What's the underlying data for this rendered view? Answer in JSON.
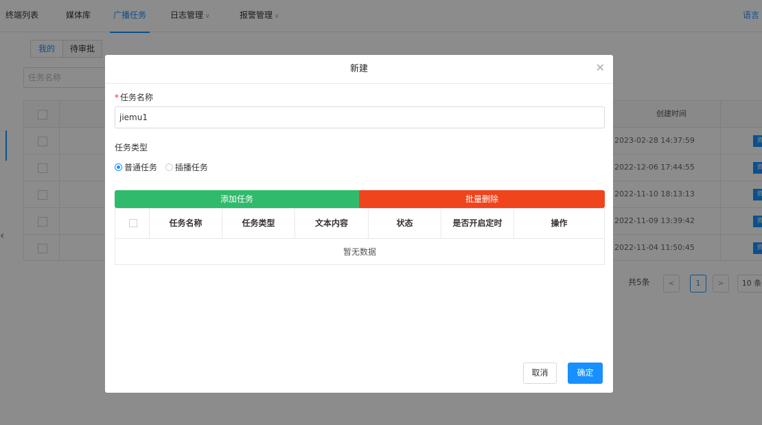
{
  "nav": {
    "items": [
      "终端列表",
      "媒体库",
      "广播任务",
      "日志管理",
      "报警管理"
    ],
    "right": "语言"
  },
  "subtabs": [
    "我的",
    "待审批"
  ],
  "search": {
    "placeholder": "任务名称"
  },
  "bg_table": {
    "created_header": "创建时间",
    "created_times": [
      "2023-02-28 14:37:59",
      "2022-12-06 17:44:55",
      "2022-11-10 18:13:13",
      "2022-11-09 13:39:42",
      "2022-11-04 11:50:45"
    ]
  },
  "pagination": {
    "total": "共5条",
    "current": "1",
    "page_size": "10 条"
  },
  "modal": {
    "title": "新建",
    "name_label": "任务名称",
    "name_value": "jiemu1",
    "type_label": "任务类型",
    "type_options": [
      "普通任务",
      "插播任务"
    ],
    "add_button": "添加任务",
    "batch_delete_button": "批量删除",
    "table_headers": [
      "任务名称",
      "任务类型",
      "文本内容",
      "状态",
      "是否开启定时",
      "操作"
    ],
    "empty_text": "暂无数据",
    "cancel": "取消",
    "ok": "确定"
  }
}
